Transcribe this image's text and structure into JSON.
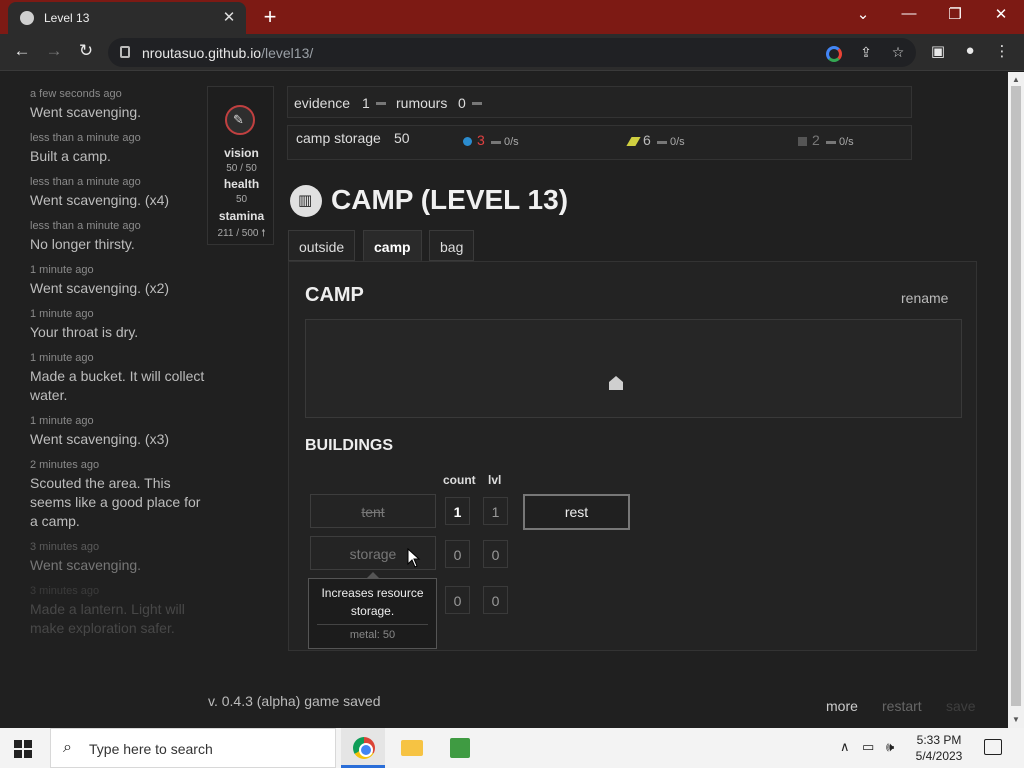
{
  "browser": {
    "tab_title": "Level 13",
    "tab_close": "✕",
    "new_tab": "+",
    "url_host": "nroutasuo.github.io",
    "url_path": "/level13/",
    "window_controls": [
      "⌄",
      "—",
      "❐",
      "✕"
    ]
  },
  "log": [
    {
      "time": "a few seconds ago",
      "text": "Went scavenging."
    },
    {
      "time": "less than a minute ago",
      "text": "Built a camp."
    },
    {
      "time": "less than a minute ago",
      "text": "Went scavenging. (x4)"
    },
    {
      "time": "less than a minute ago",
      "text": "No longer thirsty."
    },
    {
      "time": "1 minute ago",
      "text": "Went scavenging. (x2)"
    },
    {
      "time": "1 minute ago",
      "text": "Your throat is dry."
    },
    {
      "time": "1 minute ago",
      "text": "Made a bucket. It will collect water."
    },
    {
      "time": "1 minute ago",
      "text": "Went scavenging. (x3)"
    },
    {
      "time": "2 minutes ago",
      "text": "Scouted the area. This seems like a good place for a camp."
    },
    {
      "time": "3 minutes ago",
      "text": "Went scavenging."
    },
    {
      "time": "3 minutes ago",
      "text": "Made a lantern. Light will make exploration safer."
    }
  ],
  "stats": {
    "vision_label": "vision",
    "vision_value": "50 / 50",
    "health_label": "health",
    "health_value": "50",
    "stamina_label": "stamina",
    "stamina_value": "211 / 500 🠕"
  },
  "top_bar": {
    "evidence_label": "evidence",
    "evidence_value": "1",
    "rumours_label": "rumours",
    "rumours_value": "0"
  },
  "storage_bar": {
    "label": "camp storage",
    "value": "50",
    "resources": [
      {
        "icon": "water-icon",
        "value": "3",
        "rate": "0/s",
        "color": "#e04040",
        "icon_color": "#2b8ccf"
      },
      {
        "icon": "food-icon",
        "value": "6",
        "rate": "0/s",
        "color": "#bbbbbb",
        "icon_color": "#cfcf40"
      },
      {
        "icon": "metal-icon",
        "value": "2",
        "rate": "0/s",
        "color": "#777777",
        "icon_color": "#555555"
      }
    ]
  },
  "camp_title": "CAMP (LEVEL 13)",
  "tabs": [
    {
      "label": "outside"
    },
    {
      "label": "camp"
    },
    {
      "label": "bag"
    }
  ],
  "panel": {
    "heading": "CAMP",
    "rename": "rename",
    "buildings_heading": "BUILDINGS",
    "col_count": "count",
    "col_lvl": "lvl",
    "buildings": [
      {
        "label": "tent",
        "count": "1",
        "lvl": "1"
      },
      {
        "label": "storage",
        "count": "0",
        "lvl": "0"
      },
      {
        "label": "",
        "count": "0",
        "lvl": "0"
      }
    ],
    "rest_button": "rest"
  },
  "tooltip": {
    "desc": "Increases resource storage.",
    "cost": "metal: 50"
  },
  "footer": {
    "version": "v. 0.4.3 (alpha) game saved",
    "more": "more",
    "restart": "restart",
    "save": "save"
  },
  "taskbar": {
    "search_placeholder": "Type here to search",
    "time": "5:33 PM",
    "date": "5/4/2023"
  }
}
